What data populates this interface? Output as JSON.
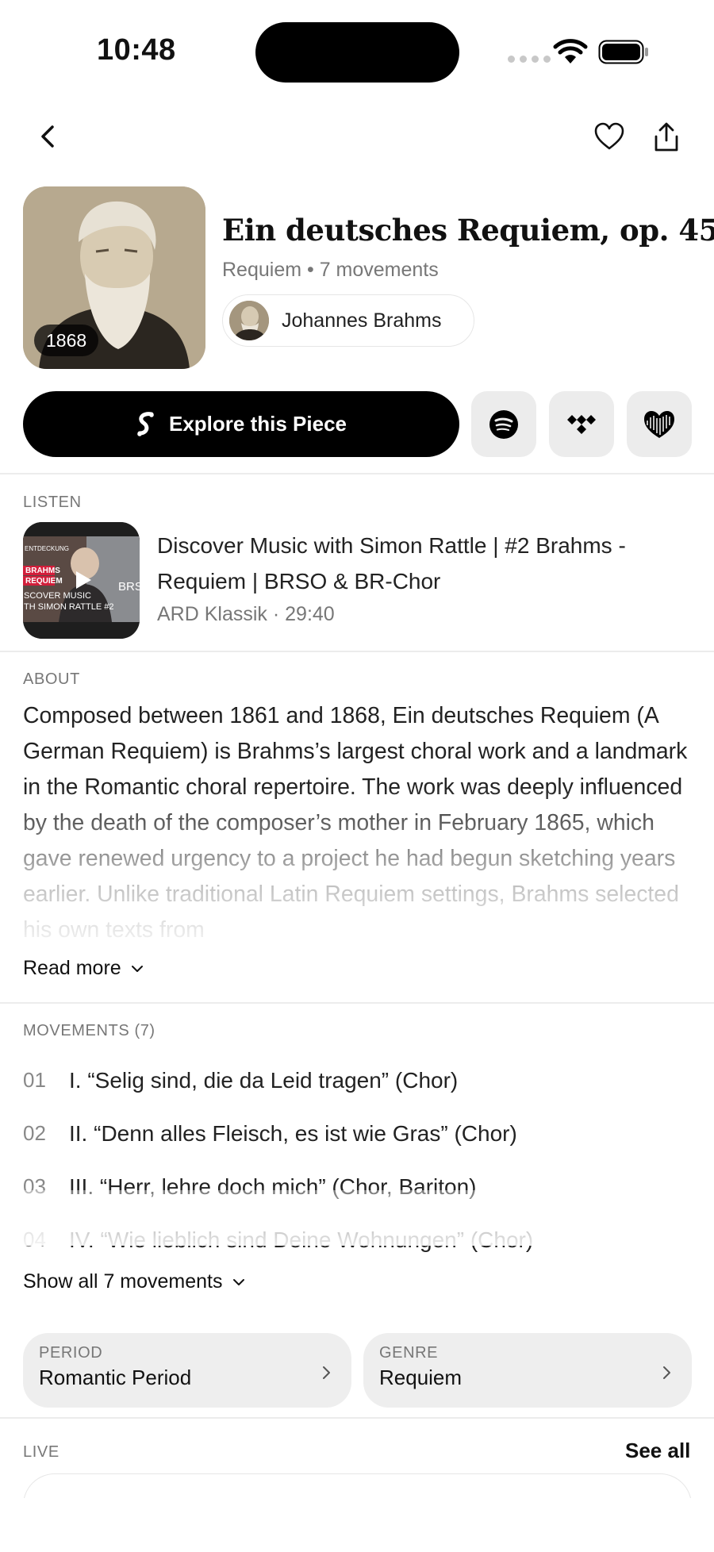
{
  "status_bar": {
    "time": "10:48"
  },
  "hero": {
    "year": "1868",
    "title": "Ein deutsches Requiem, op. 45",
    "meta": "Requiem • 7 movements",
    "composer": "Johannes Brahms"
  },
  "actions": {
    "explore_label": "Explore this Piece",
    "services": [
      "spotify-icon",
      "tidal-icon",
      "deezer-icon"
    ]
  },
  "listen": {
    "section_label": "LISTEN",
    "video_title": "Discover Music with Simon Rattle | #2 Brahms - Requiem | BRSO & BR-Chor",
    "video_meta": "ARD Klassik · 29:40",
    "thumb_text": [
      "BRAHMS",
      "REQUIEM",
      "SCOVER MUSIC",
      "TH SIMON RATTLE #2",
      "BRS"
    ]
  },
  "about": {
    "section_label": "ABOUT",
    "text": "Composed between 1861 and 1868, Ein deutsches Requiem (A German Requiem) is Brahms’s largest choral work and a landmark in the Romantic choral repertoire. The work was deeply influenced by the death of the composer’s mother in February 1865, which gave renewed urgency to a project he had begun sketching years earlier. Unlike traditional Latin Requiem settings, Brahms selected his own texts from",
    "read_more": "Read more"
  },
  "movements": {
    "section_label": "MOVEMENTS (7)",
    "items": [
      {
        "num": "01",
        "title": "I. “Selig sind, die da Leid tragen” (Chor)"
      },
      {
        "num": "02",
        "title": "II. “Denn alles Fleisch, es ist wie Gras” (Chor)"
      },
      {
        "num": "03",
        "title": "III. “Herr, lehre doch mich” (Chor, Bariton)"
      },
      {
        "num": "04",
        "title": "IV. “Wie lieblich sind Deine Wohnungen” (Chor)"
      }
    ],
    "show_all": "Show all 7 movements"
  },
  "tags": [
    {
      "label": "PERIOD",
      "value": "Romantic Period"
    },
    {
      "label": "GENRE",
      "value": "Requiem"
    }
  ],
  "live": {
    "section_label": "LIVE",
    "see_all": "See all"
  }
}
